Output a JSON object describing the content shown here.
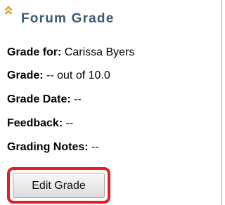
{
  "panel": {
    "title": "Forum Grade",
    "accent_color": "#3b5a78",
    "collapse_icon": "double-chevron-up-icon",
    "fields": [
      {
        "label": "Grade for:",
        "value": " Carissa Byers"
      },
      {
        "label": "Grade:",
        "value": " -- out of 10.0"
      },
      {
        "label": "Grade Date:",
        "value": "  --"
      },
      {
        "label": "Feedback:",
        "value": " --"
      },
      {
        "label": "Grading Notes:",
        "value": " --"
      }
    ],
    "edit_button_label": "Edit Grade",
    "highlight_color": "#e51d22"
  }
}
